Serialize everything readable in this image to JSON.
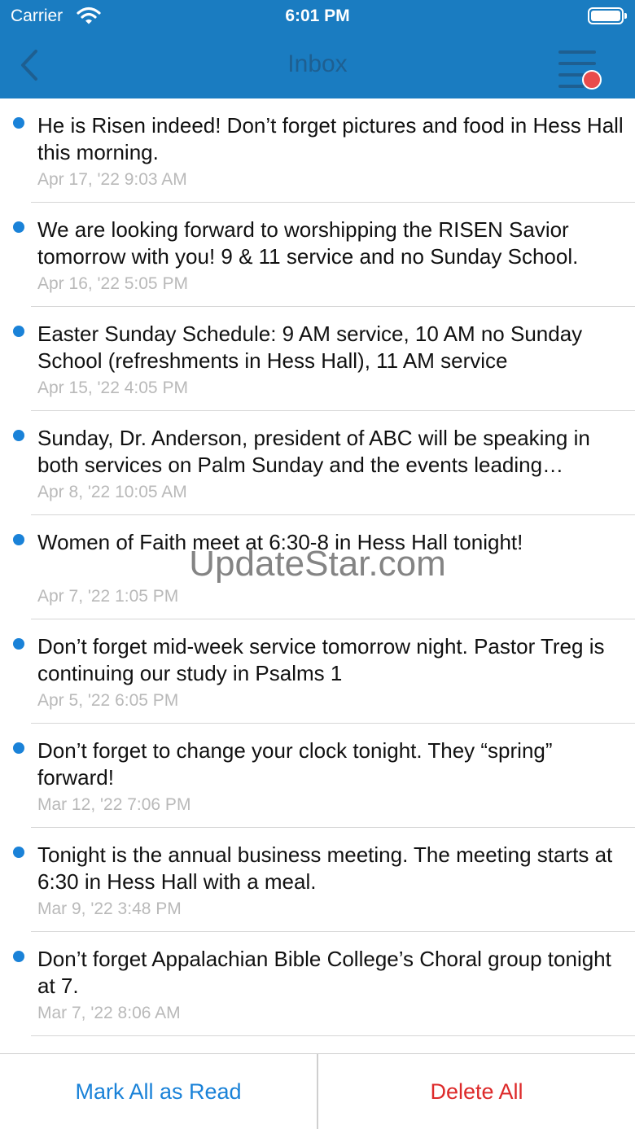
{
  "status_bar": {
    "carrier": "Carrier",
    "time": "6:01 PM"
  },
  "nav": {
    "title": "Inbox",
    "back_icon": "chevron-left-icon",
    "menu_icon": "menu-lines-icon"
  },
  "colors": {
    "header": "#1a7cc1",
    "accent_blue": "#1a82d8",
    "danger_red": "#dd2a2a",
    "badge_red": "#e94b4b"
  },
  "messages": [
    {
      "text": "He is Risen indeed! Don’t forget pictures and food in Hess Hall this morning.",
      "date": "Apr 17, '22 9:03 AM",
      "unread": true
    },
    {
      "text": "We are looking forward to worshipping the RISEN Savior tomorrow with you! 9 & 11 service and no Sunday School.",
      "date": "Apr 16, '22 5:05 PM",
      "unread": true
    },
    {
      "text": "Easter Sunday Schedule: 9 AM service, 10 AM no Sunday School (refreshments in Hess Hall), 11 AM service",
      "date": "Apr 15, '22 4:05 PM",
      "unread": true
    },
    {
      "text": "Sunday, Dr. Anderson, president of ABC will be speaking in both services on Palm Sunday and the events leading…",
      "date": "Apr 8, '22 10:05 AM",
      "unread": true
    },
    {
      "text": "Women of Faith meet at 6:30-8 in Hess Hall tonight!",
      "date": "Apr 7, '22 1:05 PM",
      "unread": true
    },
    {
      "text": "Don’t forget mid-week service tomorrow night. Pastor Treg is continuing our study in Psalms 1",
      "date": "Apr 5, '22 6:05 PM",
      "unread": true
    },
    {
      "text": "Don’t forget to change your clock tonight. They “spring” forward!",
      "date": "Mar 12, '22 7:06 PM",
      "unread": true
    },
    {
      "text": "Tonight is the annual business meeting. The meeting starts at 6:30 in Hess Hall with a meal.",
      "date": "Mar 9, '22 3:48 PM",
      "unread": true
    },
    {
      "text": "Don’t forget Appalachian Bible College’s Choral group tonight at 7.",
      "date": "Mar 7, '22 8:06 AM",
      "unread": true
    }
  ],
  "watermark": "UpdateStar.com",
  "bottom_bar": {
    "mark_all_label": "Mark All as Read",
    "delete_all_label": "Delete All"
  }
}
